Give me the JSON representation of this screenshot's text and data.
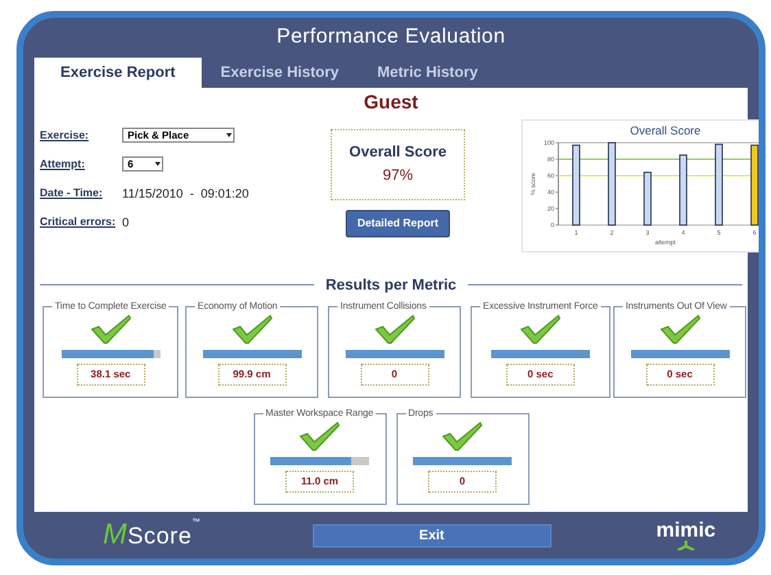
{
  "window": {
    "title": "Performance Evaluation"
  },
  "tabs": [
    {
      "label": "Exercise Report",
      "selected": true
    },
    {
      "label": "Exercise History",
      "selected": false
    },
    {
      "label": "Metric History",
      "selected": false
    }
  ],
  "user": "Guest",
  "form": [
    {
      "label": "Exercise:",
      "kind": "dropdown",
      "value": "Pick & Place"
    },
    {
      "label": "Attempt:",
      "kind": "dropdown",
      "value": "6"
    },
    {
      "label": "Date - Time:",
      "kind": "text",
      "value": "11/15/2010  -  09:01:20"
    },
    {
      "label": "Critical errors:",
      "kind": "text",
      "value": "0"
    }
  ],
  "overall": {
    "title": "Overall Score",
    "value": "97%"
  },
  "detailed_button": "Detailed Report",
  "chart": {
    "chart_data": {
      "type": "bar",
      "title": "Overall Score",
      "xlabel": "attempt",
      "ylabel": "% score",
      "categories": [
        "1",
        "2",
        "3",
        "4",
        "5",
        "6"
      ],
      "ylim": [
        0,
        100
      ],
      "yticks": [
        0,
        20,
        40,
        60,
        80,
        100
      ],
      "series": [
        {
          "color": "#c9d9f1",
          "values": [
            97,
            100,
            64,
            85,
            98,
            null
          ]
        },
        {
          "color": "#f2c81c",
          "values": [
            null,
            null,
            null,
            null,
            null,
            97
          ]
        }
      ],
      "ref_lines": [
        {
          "axis": "y",
          "value": 80,
          "color": "#8cd25a"
        },
        {
          "axis": "y",
          "value": 60,
          "color": "#e8e84a"
        }
      ]
    }
  },
  "results_heading": "Results per Metric",
  "metrics": [
    {
      "title": "Time to Complete Exercise",
      "passed": true,
      "level": 0.93,
      "value": "38.1 sec"
    },
    {
      "title": "Economy of Motion",
      "passed": true,
      "level": 1,
      "value": "99.9 cm"
    },
    {
      "title": "Instrument Collisions",
      "passed": true,
      "level": 1,
      "value": "0"
    },
    {
      "title": "Excessive Instrument Force",
      "passed": true,
      "level": 1,
      "value": "0 sec"
    },
    {
      "title": "Instruments Out Of View",
      "passed": true,
      "level": 1,
      "value": "0 sec"
    },
    {
      "title": "Master Workspace Range",
      "passed": true,
      "level": 0.82,
      "value": "11.0 cm"
    },
    {
      "title": "Drops",
      "passed": true,
      "level": 1,
      "value": "0"
    }
  ],
  "footer": {
    "logo": {
      "mark": "M",
      "name": "Score",
      "tm": "™"
    },
    "exit_button": "Exit",
    "brand": "mimic"
  }
}
